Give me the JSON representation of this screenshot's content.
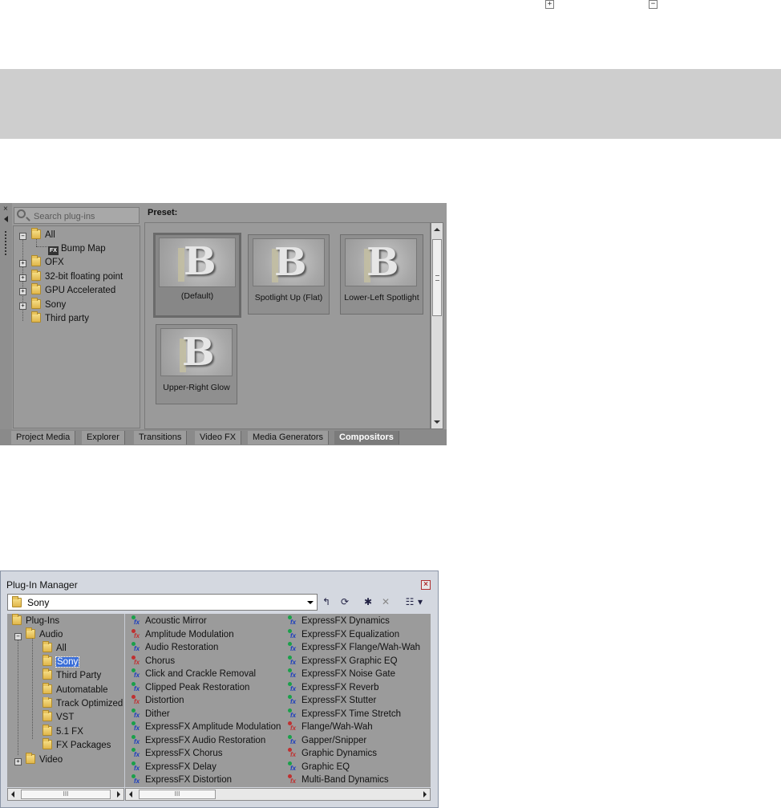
{
  "top_icons": {
    "expand": "+",
    "collapse": "−"
  },
  "explorer": {
    "close_glyph": "×",
    "search_placeholder": "Search plug-ins",
    "tree": [
      {
        "label": "All",
        "expand": "−"
      },
      {
        "label": "Bump Map",
        "icon": "fx-plugin-icon"
      },
      {
        "label": "OFX",
        "expand": "+"
      },
      {
        "label": "32-bit floating point",
        "expand": "+"
      },
      {
        "label": "GPU Accelerated",
        "expand": "+"
      },
      {
        "label": "Sony",
        "expand": "+"
      },
      {
        "label": "Third party"
      }
    ],
    "preset_label": "Preset:",
    "presets": [
      {
        "label": "(Default)",
        "thumb_letter": "B",
        "selected": true
      },
      {
        "label": "Spotlight Up (Flat)",
        "thumb_letter": "B"
      },
      {
        "label": "Lower-Left Spotlight",
        "thumb_letter": "B"
      },
      {
        "label": "Upper-Right Glow",
        "thumb_letter": "B"
      }
    ],
    "tabs": [
      "Project Media",
      "Explorer",
      "Transitions",
      "Video FX",
      "Media Generators",
      "Compositors"
    ],
    "active_tab": "Compositors",
    "scroll_grip": "≡"
  },
  "plugin_manager": {
    "title": "Plug-In Manager",
    "close_glyph": "×",
    "location": "Sony",
    "toolbar_glyphs": {
      "up_folder": "↰",
      "refresh": "⟳",
      "new_folder": "✱",
      "delete": "✕",
      "views": "☷",
      "views_dd": "▾"
    },
    "tree": [
      {
        "label": "Plug-Ins"
      },
      {
        "label": "Audio",
        "expand": "−"
      },
      {
        "label": "All"
      },
      {
        "label": "Sony",
        "selected": true
      },
      {
        "label": "Third Party"
      },
      {
        "label": "Automatable"
      },
      {
        "label": "Track Optimized"
      },
      {
        "label": "VST"
      },
      {
        "label": "5.1 FX"
      },
      {
        "label": "FX Packages"
      },
      {
        "label": "Video",
        "expand": "+"
      }
    ],
    "plugins_col1": [
      {
        "label": "Acoustic Mirror",
        "icon": "fx-plugin-icon"
      },
      {
        "label": "Amplitude Modulation",
        "icon": "fx-plugin-red-icon"
      },
      {
        "label": "Audio Restoration",
        "icon": "fx-plugin-icon"
      },
      {
        "label": "Chorus",
        "icon": "fx-plugin-red-icon"
      },
      {
        "label": "Click and Crackle Removal",
        "icon": "fx-plugin-icon"
      },
      {
        "label": "Clipped Peak Restoration",
        "icon": "fx-plugin-icon"
      },
      {
        "label": "Distortion",
        "icon": "fx-plugin-red-icon"
      },
      {
        "label": "Dither",
        "icon": "fx-plugin-icon"
      },
      {
        "label": "ExpressFX Amplitude Modulation",
        "icon": "fx-plugin-icon"
      },
      {
        "label": "ExpressFX Audio Restoration",
        "icon": "fx-plugin-icon"
      },
      {
        "label": "ExpressFX Chorus",
        "icon": "fx-plugin-icon"
      },
      {
        "label": "ExpressFX Delay",
        "icon": "fx-plugin-icon"
      },
      {
        "label": "ExpressFX Distortion",
        "icon": "fx-plugin-icon"
      }
    ],
    "plugins_col2": [
      {
        "label": "ExpressFX Dynamics",
        "icon": "fx-plugin-icon"
      },
      {
        "label": "ExpressFX Equalization",
        "icon": "fx-plugin-icon"
      },
      {
        "label": "ExpressFX Flange/Wah-Wah",
        "icon": "fx-plugin-icon"
      },
      {
        "label": "ExpressFX Graphic EQ",
        "icon": "fx-plugin-icon"
      },
      {
        "label": "ExpressFX Noise Gate",
        "icon": "fx-plugin-icon"
      },
      {
        "label": "ExpressFX Reverb",
        "icon": "fx-plugin-icon"
      },
      {
        "label": "ExpressFX Stutter",
        "icon": "fx-plugin-icon"
      },
      {
        "label": "ExpressFX Time Stretch",
        "icon": "fx-plugin-icon"
      },
      {
        "label": "Flange/Wah-Wah",
        "icon": "fx-plugin-red-icon"
      },
      {
        "label": "Gapper/Snipper",
        "icon": "fx-plugin-icon"
      },
      {
        "label": "Graphic Dynamics",
        "icon": "fx-plugin-red-icon"
      },
      {
        "label": "Graphic EQ",
        "icon": "fx-plugin-icon"
      },
      {
        "label": "Multi-Band Dynamics",
        "icon": "fx-plugin-red-icon"
      }
    ],
    "scroll_grip": "III"
  }
}
